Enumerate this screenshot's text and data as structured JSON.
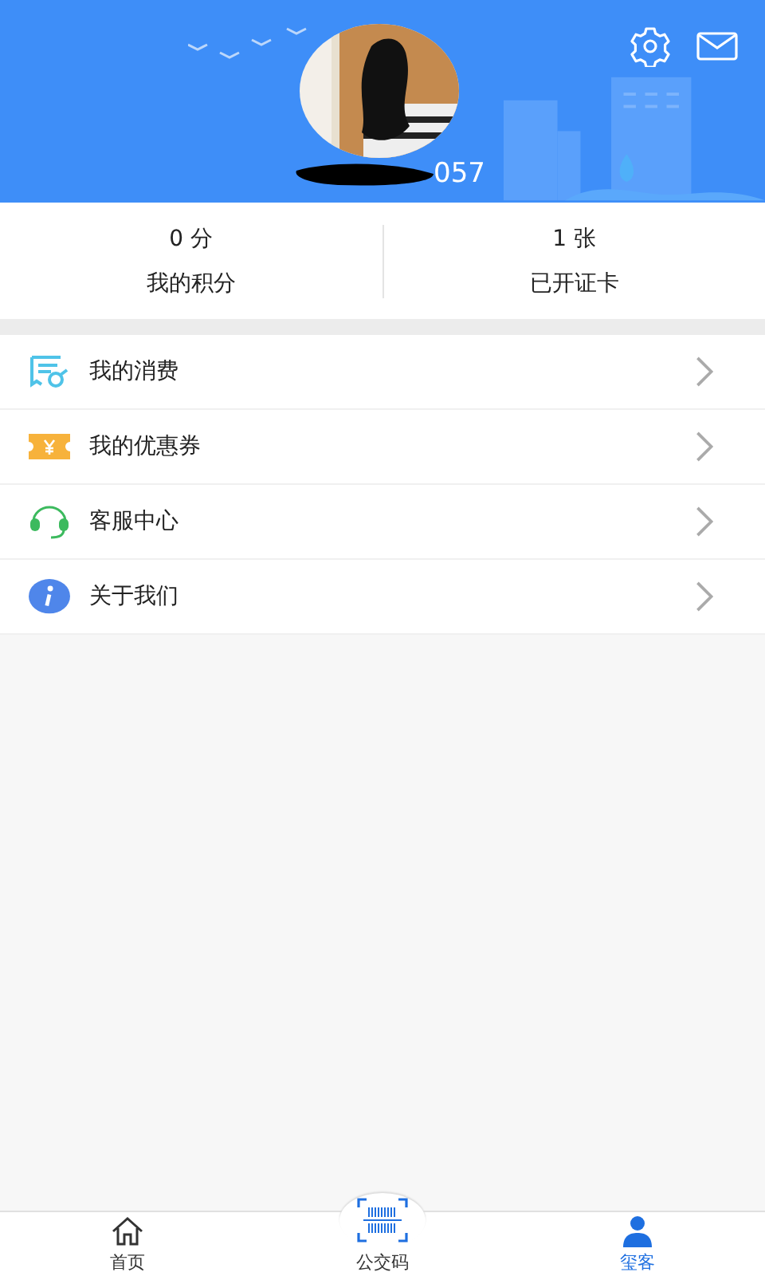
{
  "header": {
    "phone_visible": "057"
  },
  "stats": [
    {
      "value": "0 分",
      "label": "我的积分"
    },
    {
      "value": "1 张",
      "label": "已开证卡"
    }
  ],
  "menu": [
    {
      "kind": "receipt",
      "label": "我的消费"
    },
    {
      "kind": "coupon",
      "label": "我的优惠券"
    },
    {
      "kind": "headset",
      "label": "客服中心"
    },
    {
      "kind": "info",
      "label": "关于我们"
    }
  ],
  "tabs": [
    {
      "kind": "home",
      "label": "首页",
      "selected": false
    },
    {
      "kind": "scan",
      "label": "公交码",
      "selected": false
    },
    {
      "kind": "user",
      "label": "玺客",
      "selected": true
    }
  ]
}
